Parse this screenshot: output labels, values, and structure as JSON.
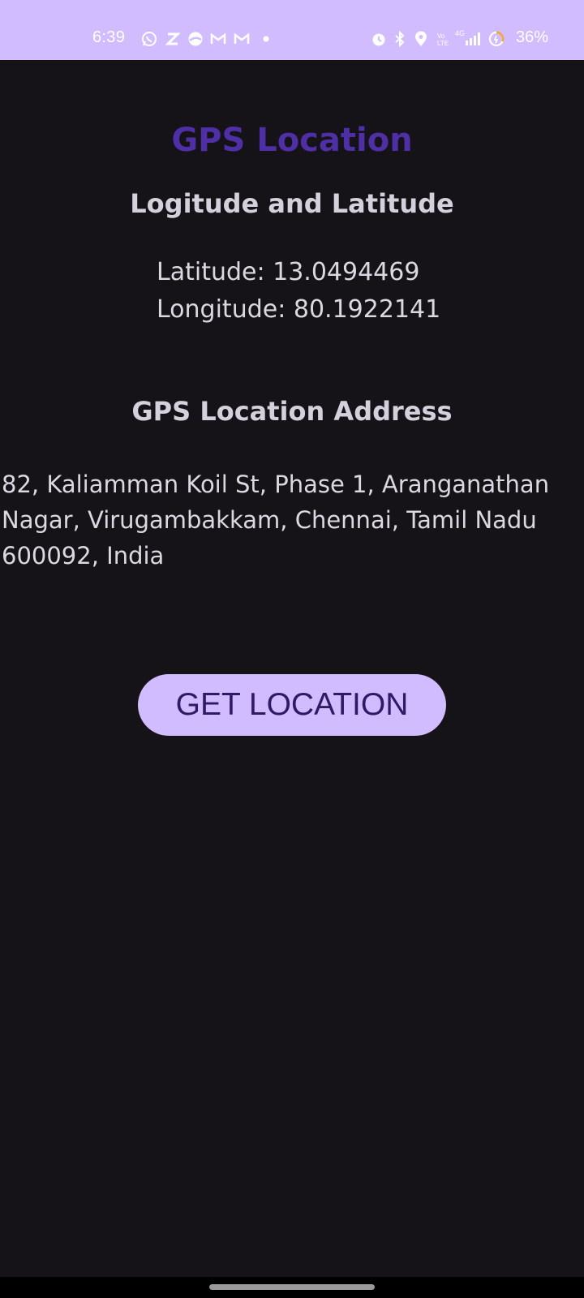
{
  "status_bar": {
    "time": "6:39",
    "battery_percent": "36%",
    "network_label": "4G",
    "left_icons": [
      "whatsapp-icon",
      "z-app-icon",
      "vpn-icon",
      "gmail-icon",
      "gmail-icon",
      "dot-icon"
    ],
    "right_icons": [
      "alarm-icon",
      "bluetooth-icon",
      "location-icon",
      "volte-icon",
      "signal-icon",
      "battery-icon"
    ],
    "background_color": "#d0bcfe"
  },
  "app": {
    "title": "GPS Location",
    "title_color": "#4f2fa6",
    "coords_heading": "Logitude and Latitude",
    "latitude_text": "Latitude: 13.0494469",
    "longitude_text": "Longitude: 80.1922141",
    "address_heading": "GPS Location Address",
    "address_line_1": "82, Kaliamman Koil St, Phase 1, Aranganathan",
    "address_line_2": "Nagar, Virugambakkam, Chennai, Tamil Nadu",
    "address_line_3": "600092, India",
    "button_label": "GET LOCATION",
    "button_color": "#d0bcfe",
    "background_color": "#151218"
  }
}
